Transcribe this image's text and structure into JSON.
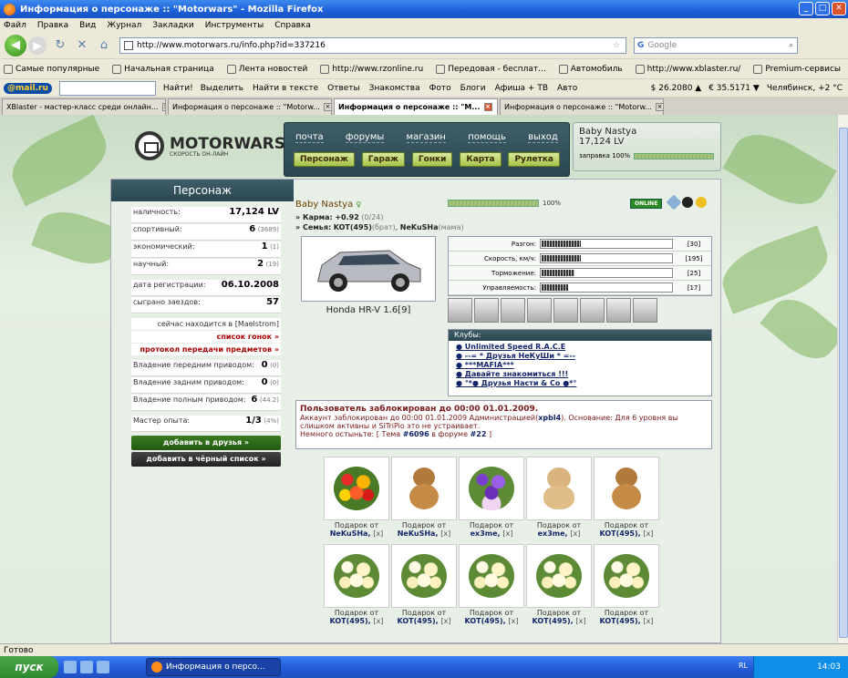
{
  "window": {
    "title": "Информация о персонаже :: \"Motorwars\" - Mozilla Firefox"
  },
  "menu": [
    "Файл",
    "Правка",
    "Вид",
    "Журнал",
    "Закладки",
    "Инструменты",
    "Справка"
  ],
  "nav": {
    "url": "http://www.motorwars.ru/info.php?id=337216",
    "search_placeholder": "Google"
  },
  "bookmarks": [
    "Самые популярные",
    "Начальная страница",
    "Лента новостей",
    "http://www.rzonline.ru",
    "Передовая - бесплат...",
    "Автомобиль",
    "http://www.xblaster.ru/",
    "Premium-сервисы"
  ],
  "mailbar": {
    "logo": "@mail.ru",
    "find": "Найти!",
    "items": [
      "Выделить",
      "Найти в тексте",
      "Ответы",
      "Знакомства",
      "Фото",
      "Блоги",
      "Афиша + ТВ",
      "Авто"
    ],
    "usd": "$ 26.2080 ▲",
    "eur": "€ 35.5171 ▼",
    "weather": "Челябинск, +2 °C"
  },
  "tabs": [
    {
      "label": "XBlaster - мастер-класс среди онлайн...",
      "active": false
    },
    {
      "label": "Информация о персонаже :: \"Motorw...",
      "active": false
    },
    {
      "label": "Информация о персонаже :: \"M...",
      "active": true
    },
    {
      "label": "Информация о персонаже :: \"Motorw...",
      "active": false
    }
  ],
  "site": {
    "logo": "MOTORWARS.RU",
    "logo_sub": "СКОРОСТЬ ОН-ЛАЙН",
    "topnav": [
      "почта",
      "форумы",
      "магазин",
      "помощь",
      "выход"
    ],
    "subnav": [
      "Персонаж",
      "Гараж",
      "Гонки",
      "Карта",
      "Рулетка"
    ],
    "user": {
      "name": "Baby Nastya",
      "lv": "17,124 LV",
      "fuel_label": "заправка 100%",
      "fuel_level": 1.0
    }
  },
  "left": {
    "title": "Персонаж",
    "cash": {
      "label": "наличность:",
      "value": "17,124 LV"
    },
    "sport": {
      "label": "спортивный:",
      "value": "6",
      "extra": "(3689)"
    },
    "eco": {
      "label": "экономический:",
      "value": "1",
      "extra": "(1)"
    },
    "sci": {
      "label": "научный:",
      "value": "2",
      "extra": "(19)"
    },
    "reg": {
      "label": "дата регистрации:",
      "value": "06.10.2008"
    },
    "races": {
      "label": "сыграно заездов:",
      "value": "57"
    },
    "location": {
      "prefix": "сейчас находится в",
      "place": "[Maelstrom]"
    },
    "race_list": "список гонок »",
    "transfer_log": "протокол передачи предметов »",
    "front": {
      "label": "Владение передним приводом:",
      "value": "0",
      "extra": "(0)"
    },
    "rear": {
      "label": "Владение задним приводом:",
      "value": "0",
      "extra": "(0)"
    },
    "full": {
      "label": "Владение полным приводом:",
      "value": "6",
      "extra": "(44.2)"
    },
    "master": {
      "label": "Мастер опыта:",
      "value": "1/3",
      "extra": "(4%)"
    },
    "add_friend": "добавить в друзья »",
    "add_black": "добавить в чёрный список »"
  },
  "profile": {
    "name": "Baby Nastya",
    "name_mark": "♀",
    "progress": 1.0,
    "progress_label": "100%",
    "online": "ONLINE",
    "karma_label": "» Карма:",
    "karma": "+0.92",
    "karma_extra": "(0/24)",
    "family_label": "» Семья:",
    "family_1": "KOT(495)",
    "family_1_role": "(брат)",
    "family_2": "NeKuSHa",
    "family_2_role": "(мама)",
    "car": "Honda HR-V 1.6[9]",
    "specs": [
      {
        "label": "Разгон:",
        "value": "[30]",
        "level": 30
      },
      {
        "label": "Скорость, км/ч:",
        "value": "[195]",
        "level": 30
      },
      {
        "label": "Торможение:",
        "value": "[25]",
        "level": 25
      },
      {
        "label": "Управляемость:",
        "value": "[17]",
        "level": 20
      }
    ],
    "clubs_title": "Клубы:",
    "clubs": [
      "Unlimited Speed R.A.C.E",
      "--= * Друзья НеКуШи * =--",
      "***MAFIA***",
      "Давайте знакомиться !!!",
      "°*● Друзья Насти & Со ●*°"
    ],
    "ban": {
      "title": "Пользователь заблокирован до 00:00 01.01.2009.",
      "line1": "Аккаунт заблокирован до 00:00 01.01.2009 Администрацией(",
      "admin": "xpbl4",
      "line1b": "). Основание: Для 6 уровня вы",
      "line2": "слишком активны и SiTriPio это не устраивает.",
      "line3a": "Немного остыньте: [ Тема ",
      "topic": "#6096",
      "line3b": " в форуме ",
      "forum": "#22",
      "line3c": " ]"
    }
  },
  "gifts": [
    {
      "type": "flowers",
      "cap": "Подарок от",
      "from": "NeKuSHa,",
      "x": "[x]"
    },
    {
      "type": "teddy",
      "cap": "Подарок от",
      "from": "NeKuSHa,",
      "x": "[x]"
    },
    {
      "type": "violet",
      "cap": "Подарок от",
      "from": "ex3me,",
      "x": "[x]"
    },
    {
      "type": "dog",
      "cap": "Подарок от",
      "from": "ex3me,",
      "x": "[x]"
    },
    {
      "type": "teddy",
      "cap": "Подарок от",
      "from": "KOT(495),",
      "x": "[x]"
    },
    {
      "type": "bouquet",
      "cap": "Подарок от",
      "from": "KOT(495),",
      "x": "[x]"
    },
    {
      "type": "bouquet",
      "cap": "Подарок от",
      "from": "KOT(495),",
      "x": "[x]"
    },
    {
      "type": "bouquet",
      "cap": "Подарок от",
      "from": "KOT(495),",
      "x": "[x]"
    },
    {
      "type": "bouquet",
      "cap": "Подарок от",
      "from": "KOT(495),",
      "x": "[x]"
    },
    {
      "type": "bouquet",
      "cap": "Подарок от",
      "from": "KOT(495),",
      "x": "[x]"
    }
  ],
  "status": "Готово",
  "taskbar": {
    "start": "пуск",
    "task": "Информация о персо...",
    "lang": "RL",
    "time": "14:03"
  }
}
